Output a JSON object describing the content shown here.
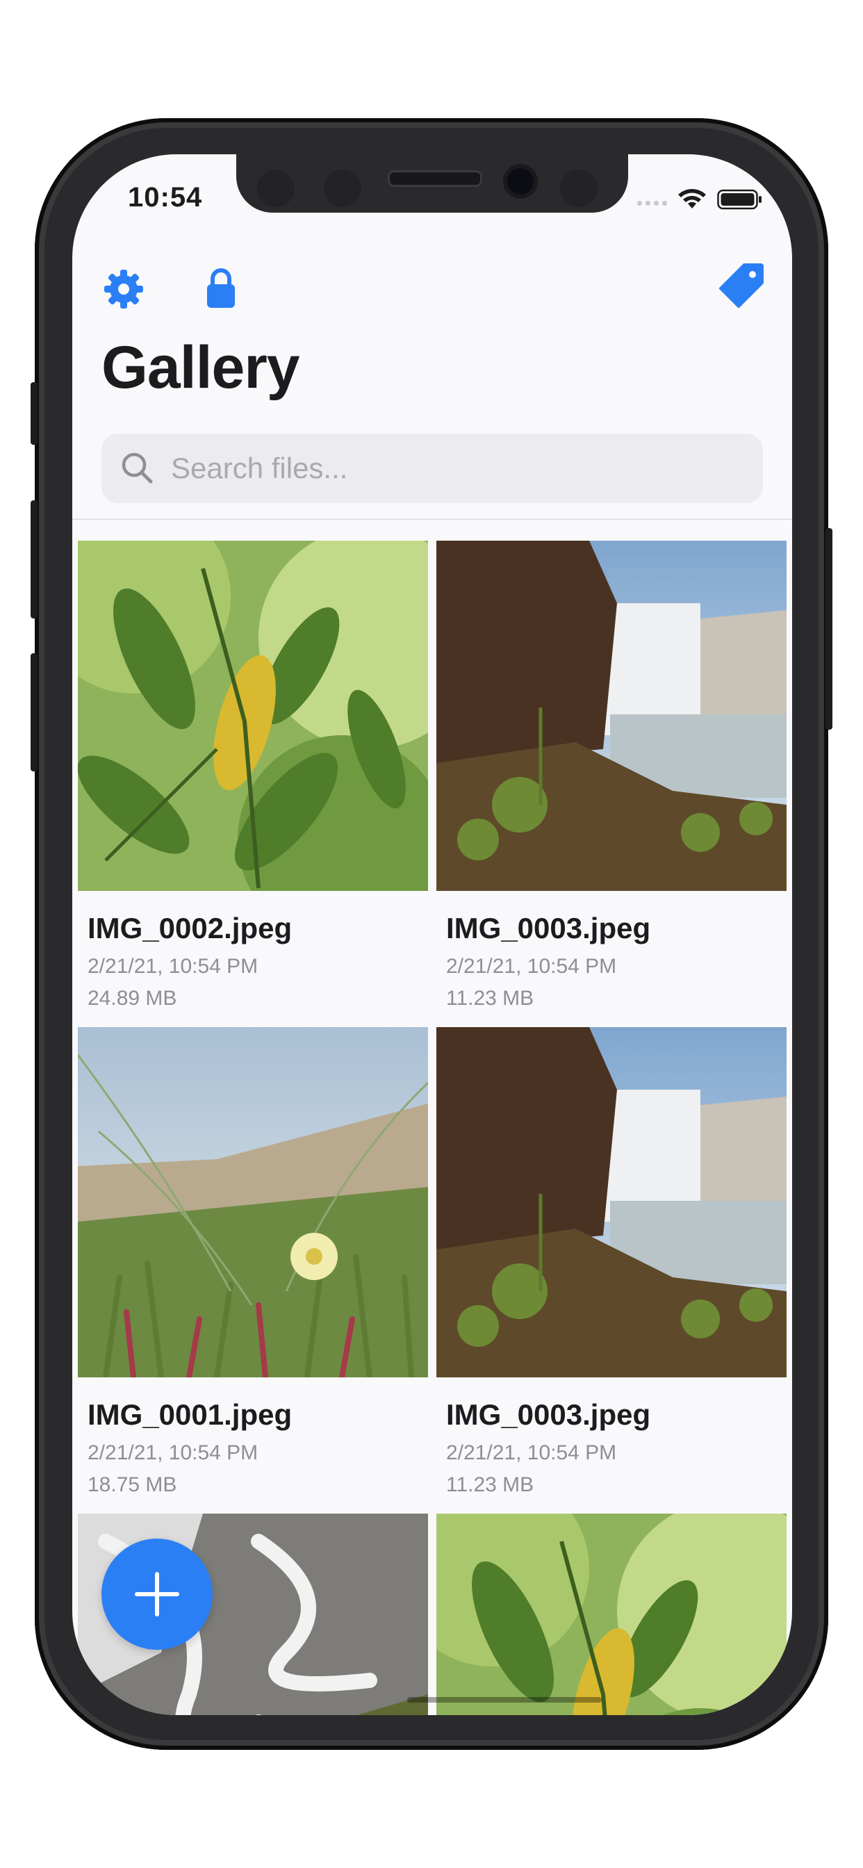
{
  "status_bar": {
    "time": "10:54"
  },
  "header": {
    "title": "Gallery",
    "settings_icon": "gear-icon",
    "lock_icon": "lock-icon",
    "tag_icon": "tag-icon",
    "accent_color": "#2b7ff5"
  },
  "search": {
    "placeholder": "Search files...",
    "value": ""
  },
  "files": [
    {
      "name": "IMG_0002.jpeg",
      "date": "2/21/21, 10:54 PM",
      "size": "24.89 MB",
      "scene": "leaves"
    },
    {
      "name": "IMG_0003.jpeg",
      "date": "2/21/21, 10:54 PM",
      "size": "11.23 MB",
      "scene": "waterfall"
    },
    {
      "name": "IMG_0001.jpeg",
      "date": "2/21/21, 10:54 PM",
      "size": "18.75 MB",
      "scene": "flower"
    },
    {
      "name": "IMG_0003.jpeg",
      "date": "2/21/21, 10:54 PM",
      "size": "11.23 MB",
      "scene": "waterfall"
    },
    {
      "scene": "stream"
    },
    {
      "scene": "leaves"
    }
  ],
  "fab": {
    "icon": "plus-icon"
  }
}
